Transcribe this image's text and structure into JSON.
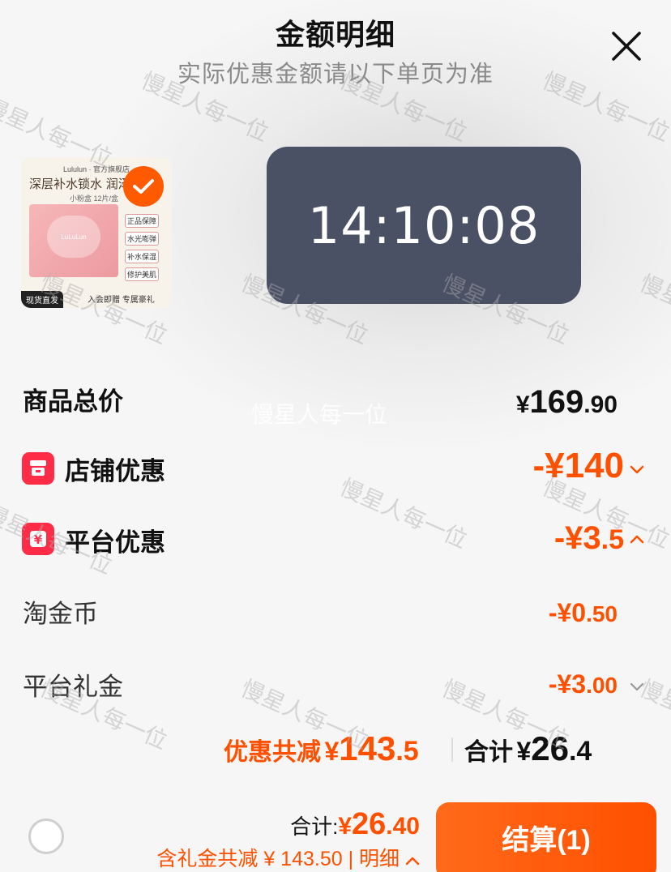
{
  "header": {
    "title": "金额明细",
    "subtitle": "实际优惠金额请以下单页为准",
    "close_icon": "close-icon"
  },
  "product": {
    "brand": "Lululun · 官方旗舰店",
    "slogan": "深层补水锁水 润泽",
    "spec": "小粉盒 12片/盒",
    "box_brand": "LuLuLun",
    "features": [
      "正品保障",
      "水光嘭弹",
      "补水保湿",
      "修护美肌"
    ],
    "badge": "现货直发",
    "gift": "入会即赠 专属豪礼",
    "selected_icon": "check-icon"
  },
  "timer": {
    "time": "14:10:08"
  },
  "rows": {
    "total": {
      "label": "商品总价",
      "currency": "¥",
      "int": "169",
      "dec": ".90"
    },
    "store": {
      "label": "店铺优惠",
      "amount": "-¥140",
      "icon": "store-icon",
      "chevron": "chevron-down-icon"
    },
    "platform": {
      "label": "平台优惠",
      "amount_int": "-¥3",
      "amount_dec": ".5",
      "icon": "yuan-coupon-icon",
      "chevron": "chevron-up-icon"
    },
    "coin": {
      "label": "淘金币",
      "amount_int": "-¥0",
      "amount_dec": ".50"
    },
    "gift": {
      "label": "平台礼金",
      "amount_int": "-¥3",
      "amount_dec": ".00",
      "chevron": "chevron-down-icon"
    }
  },
  "summary": {
    "discount_label": "优惠共减",
    "discount_currency": "¥",
    "discount_int": "143",
    "discount_dec": ".5",
    "total_label": "合计",
    "total_currency": "¥",
    "total_int": "26",
    "total_dec": ".4"
  },
  "footer": {
    "total_label": "合计:",
    "total_currency": "¥",
    "total_int": "26",
    "total_dec": ".40",
    "note": "含礼金共减 ¥ 143.50 | 明细",
    "note_chevron": "chevron-up-icon",
    "checkout_label": "结算(1)"
  },
  "watermark": {
    "text": "慢星人每一位"
  },
  "colors": {
    "accent": "#ff5000",
    "timer_bg": "#4b5165",
    "icon_red": "#ff2c48"
  }
}
